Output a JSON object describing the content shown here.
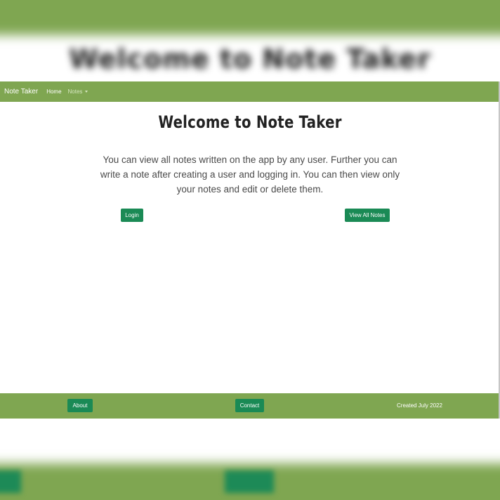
{
  "navbar": {
    "brand": "Note Taker",
    "links": [
      {
        "label": "Home"
      },
      {
        "label": "Notes"
      }
    ]
  },
  "hero": {
    "title": "Welcome to Note Taker",
    "intro_lines": [
      "You can view all notes written on the app by any user. Further you can",
      "write a note after creating a user and logging in. You can then view only",
      "your notes and edit or delete them."
    ],
    "login_label": "Login",
    "view_all_label": "View All Notes"
  },
  "footer": {
    "about_label": "About",
    "contact_label": "Contact",
    "created_text": "Created July 2022"
  },
  "colors": {
    "bar_green": "#7fa651",
    "button_green": "#1a8a55",
    "text_dark": "#222222"
  }
}
